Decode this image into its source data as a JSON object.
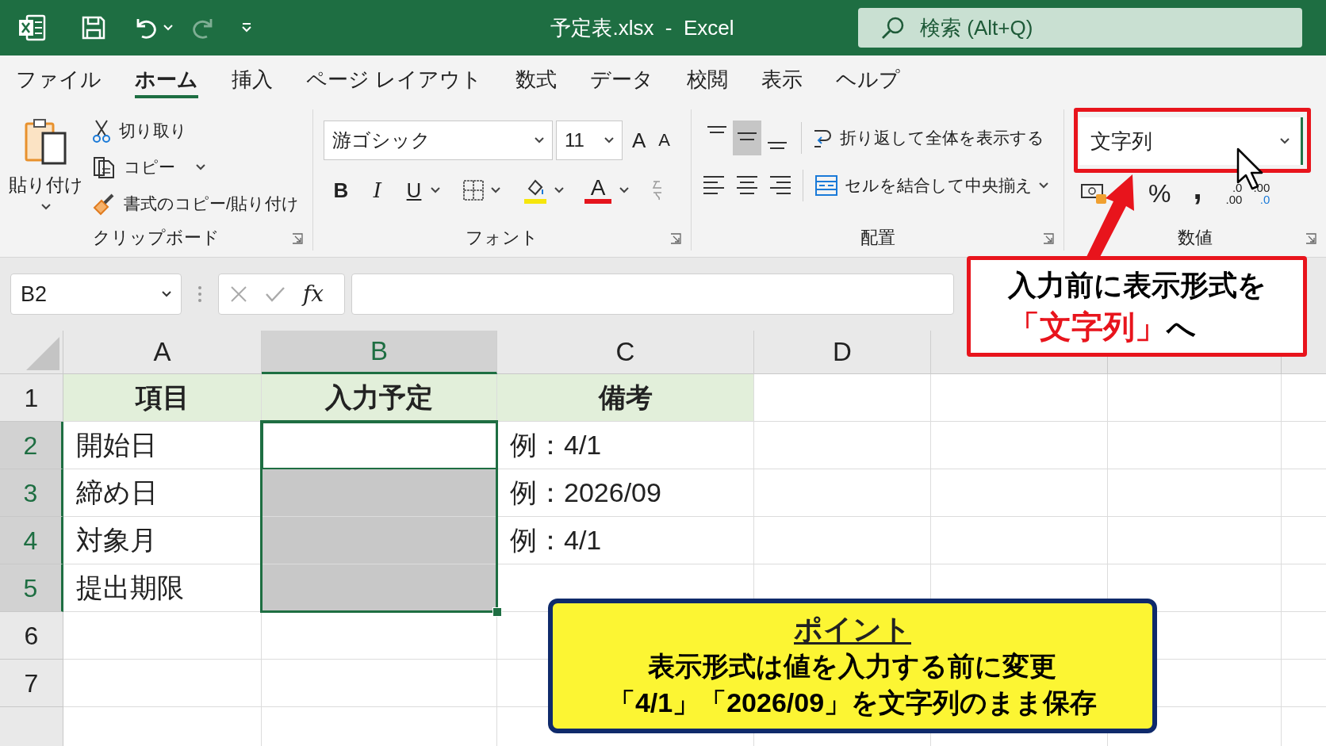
{
  "window": {
    "title": "予定表.xlsx  -  Excel"
  },
  "search": {
    "placeholder": "検索 (Alt+Q)"
  },
  "tabs": [
    {
      "label": "ファイル",
      "selected": false
    },
    {
      "label": "ホーム",
      "selected": true
    },
    {
      "label": "挿入",
      "selected": false
    },
    {
      "label": "ページ レイアウト",
      "selected": false
    },
    {
      "label": "数式",
      "selected": false
    },
    {
      "label": "データ",
      "selected": false
    },
    {
      "label": "校閲",
      "selected": false
    },
    {
      "label": "表示",
      "selected": false
    },
    {
      "label": "ヘルプ",
      "selected": false
    }
  ],
  "clipboard": {
    "label": "クリップボード",
    "paste": "貼り付け",
    "cut": "切り取り",
    "copy": "コピー",
    "format_painter": "書式のコピー/貼り付け"
  },
  "font": {
    "label": "フォント",
    "font_name": "游ゴシック",
    "font_size": "11",
    "grow": "A",
    "shrink": "A",
    "bold": "B",
    "italic": "I",
    "underline": "U",
    "font_color": "A"
  },
  "alignment": {
    "label": "配置",
    "vertical_align": [
      {
        "selected": false
      },
      {
        "selected": true
      },
      {
        "selected": false
      }
    ],
    "wrap_text": "折り返して全体を表示する",
    "merge_center": "セルを結合して中央揃え"
  },
  "number": {
    "label": "数値",
    "format": "文字列",
    "percent": "%",
    "comma": ",",
    "increase_decimal": {
      "top": ".0",
      "bottom": ".00"
    },
    "decrease_decimal": {
      "top": ".00",
      "bottom": ".0"
    }
  },
  "formula_bar": {
    "name_box": "B2",
    "function_label": "fx"
  },
  "sheet": {
    "columns": [
      {
        "label": "A",
        "selected": false
      },
      {
        "label": "B",
        "selected": true
      },
      {
        "label": "C",
        "selected": false
      },
      {
        "label": "D",
        "selected": false
      }
    ],
    "rows": [
      {
        "number": "1",
        "selected": false,
        "active": false,
        "header": true,
        "cells": {
          "A": "項目",
          "B": "入力予定",
          "C": "備考"
        }
      },
      {
        "number": "2",
        "selected": true,
        "active": true,
        "header": false,
        "cells": {
          "A": "開始日",
          "C": "例：4/1"
        }
      },
      {
        "number": "3",
        "selected": true,
        "active": false,
        "header": false,
        "cells": {
          "A": "締め日",
          "C": "例：2026/09"
        }
      },
      {
        "number": "4",
        "selected": true,
        "active": false,
        "header": false,
        "cells": {
          "A": "対象月",
          "C": "例：4/1"
        }
      },
      {
        "number": "5",
        "selected": true,
        "active": false,
        "header": false,
        "cells": {
          "A": "提出期限"
        }
      },
      {
        "number": "6",
        "selected": false,
        "active": false,
        "header": false,
        "cells": {}
      },
      {
        "number": "7",
        "selected": false,
        "active": false,
        "header": false,
        "cells": {}
      }
    ]
  },
  "callout": {
    "lines": [
      [
        {
          "text": "入力前に表示形式を",
          "emphasis": false
        }
      ],
      [
        {
          "text": "「文字列」",
          "emphasis": true
        },
        {
          "text": "へ",
          "emphasis": false
        }
      ]
    ]
  },
  "point": {
    "title": "ポイント",
    "lines": [
      "表示形式は値を入力する前に変更",
      "「4/1」「2026/09」を文字列のまま保存"
    ]
  }
}
